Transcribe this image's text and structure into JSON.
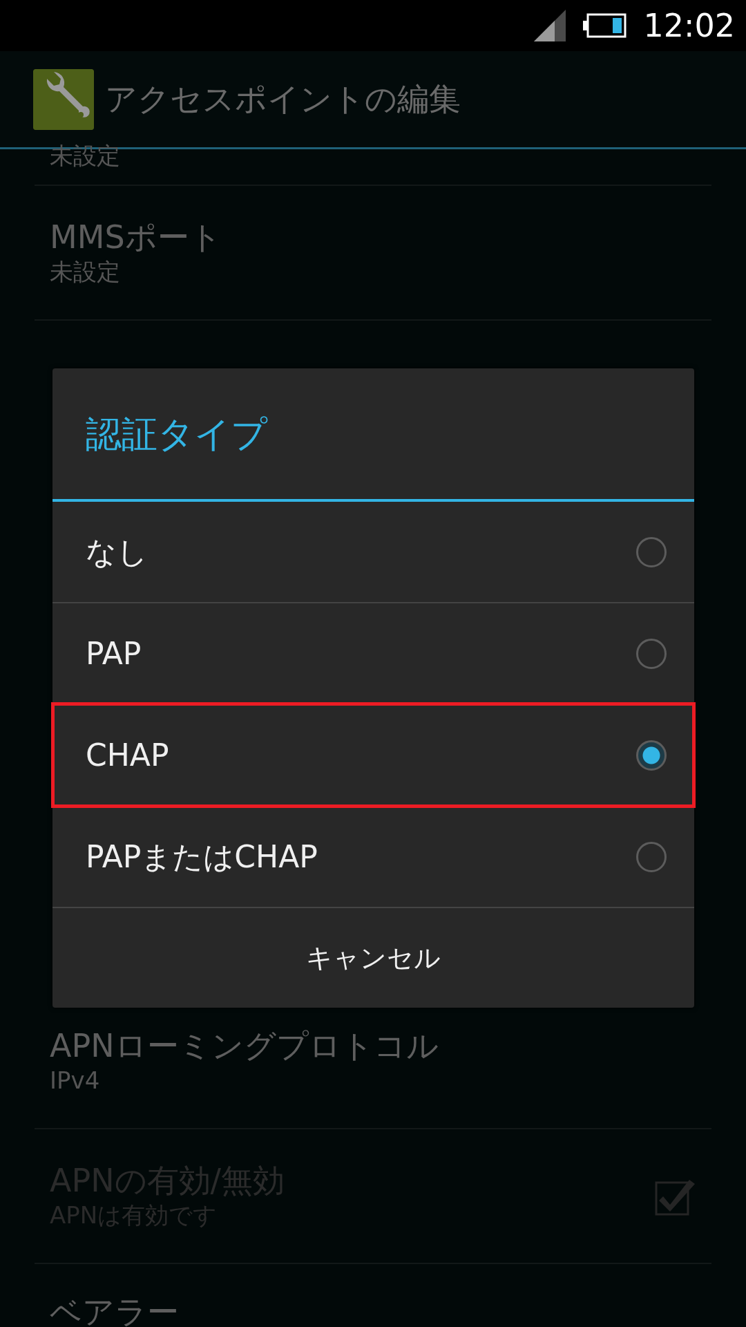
{
  "status_bar": {
    "time": "12:02"
  },
  "action_bar": {
    "title": "アクセスポイントの編集"
  },
  "settings": [
    {
      "kind": "partial",
      "summary": "未設定",
      "enabled": true
    },
    {
      "kind": "text",
      "title": "MMSポート",
      "summary": "未設定",
      "enabled": true
    },
    {
      "kind": "hidden"
    },
    {
      "kind": "text",
      "title": "APNローミングプロトコル",
      "summary": "IPv4",
      "enabled": true
    },
    {
      "kind": "checkbox",
      "title": "APNの有効/無効",
      "summary": "APNは有効です",
      "enabled": false,
      "checked": true
    },
    {
      "kind": "cut",
      "title": "ベアラー",
      "enabled": true
    }
  ],
  "dialog": {
    "title": "認証タイプ",
    "options": [
      {
        "label": "なし",
        "selected": false,
        "highlighted": false
      },
      {
        "label": "PAP",
        "selected": false,
        "highlighted": false
      },
      {
        "label": "CHAP",
        "selected": true,
        "highlighted": true
      },
      {
        "label": "PAPまたはCHAP",
        "selected": false,
        "highlighted": false
      }
    ],
    "cancel": "キャンセル"
  }
}
